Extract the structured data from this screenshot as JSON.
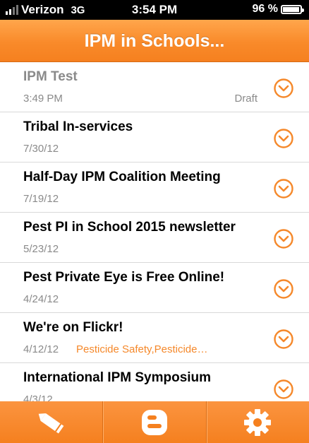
{
  "status_bar": {
    "carrier": "Verizon",
    "network": "3G",
    "time": "3:54 PM",
    "battery_label": "96 %",
    "battery_level": 0.96,
    "signal_bars": 2
  },
  "nav": {
    "title": "IPM in Schools..."
  },
  "posts": [
    {
      "title": "IPM Test",
      "date": "3:49 PM",
      "status": "Draft",
      "tags": "",
      "is_draft": true
    },
    {
      "title": "Tribal In-services",
      "date": "7/30/12",
      "status": "",
      "tags": "",
      "is_draft": false
    },
    {
      "title": "Half-Day IPM Coalition Meeting",
      "date": "7/19/12",
      "status": "",
      "tags": "",
      "is_draft": false
    },
    {
      "title": "Pest PI in School 2015 newsletter",
      "date": "5/23/12",
      "status": "",
      "tags": "",
      "is_draft": false
    },
    {
      "title": "Pest Private Eye is Free Online!",
      "date": "4/24/12",
      "status": "",
      "tags": "",
      "is_draft": false
    },
    {
      "title": "We're on Flickr!",
      "date": "4/12/12",
      "status": "",
      "tags": "Pesticide Safety,Pesticide…",
      "is_draft": false
    },
    {
      "title": "International IPM Symposium",
      "date": "4/3/12",
      "status": "",
      "tags": "",
      "is_draft": false
    }
  ],
  "tabbar": {
    "items": [
      {
        "icon": "pencil-icon"
      },
      {
        "icon": "blogger-icon"
      },
      {
        "icon": "gear-icon"
      }
    ]
  },
  "colors": {
    "accent": "#f5801f",
    "draft_text": "#8a8a8a",
    "tag_text": "#f5882a"
  }
}
